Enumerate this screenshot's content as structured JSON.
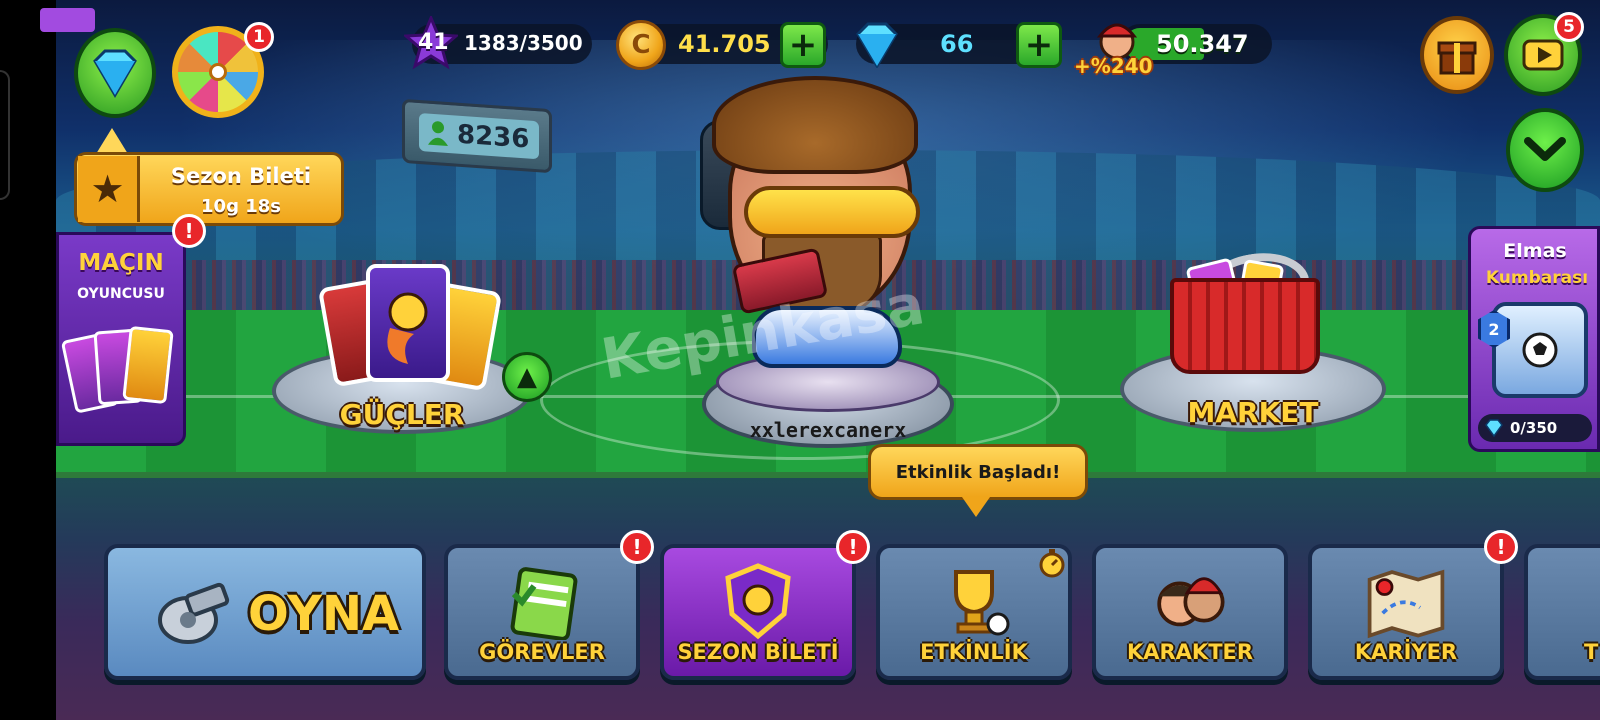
{
  "top_bar": {
    "level": "41",
    "xp": "1383/3500",
    "xp_progress": 0.395,
    "coins": "41.705",
    "gems": "66",
    "fans": "50.347",
    "fans_bonus": "+%240"
  },
  "badges": {
    "wheel": "1",
    "video": "5",
    "alert": "!"
  },
  "season_pass": {
    "title": "Sezon Bileti",
    "time_left": "10g 18s"
  },
  "online_count": "8236",
  "player_of_match": {
    "title": "MAÇIN",
    "subtitle": "OYUNCUSU"
  },
  "platforms": {
    "powers": "GÜÇLER",
    "market": "MARKET"
  },
  "player_name": "xxlerexcanerx",
  "watermark": "Kepinkasa",
  "event_tooltip": "Etkinlik Başladı!",
  "gem_bank": {
    "title": "Elmas",
    "subtitle": "Kumbarası",
    "level": "2",
    "progress": "0/350"
  },
  "menu": {
    "play": "OYNA",
    "tasks": "GÖREVLER",
    "season_pass": "SEZON BİLETİ",
    "event": "ETKİNLİK",
    "character": "KARAKTER",
    "career": "KARİYER",
    "partial": "T"
  },
  "colors": {
    "accent_gold": "#ffd23a",
    "alert_red": "#e8262a",
    "green_button": "#2aa82a",
    "purple_selected": "#6a1aa8"
  }
}
